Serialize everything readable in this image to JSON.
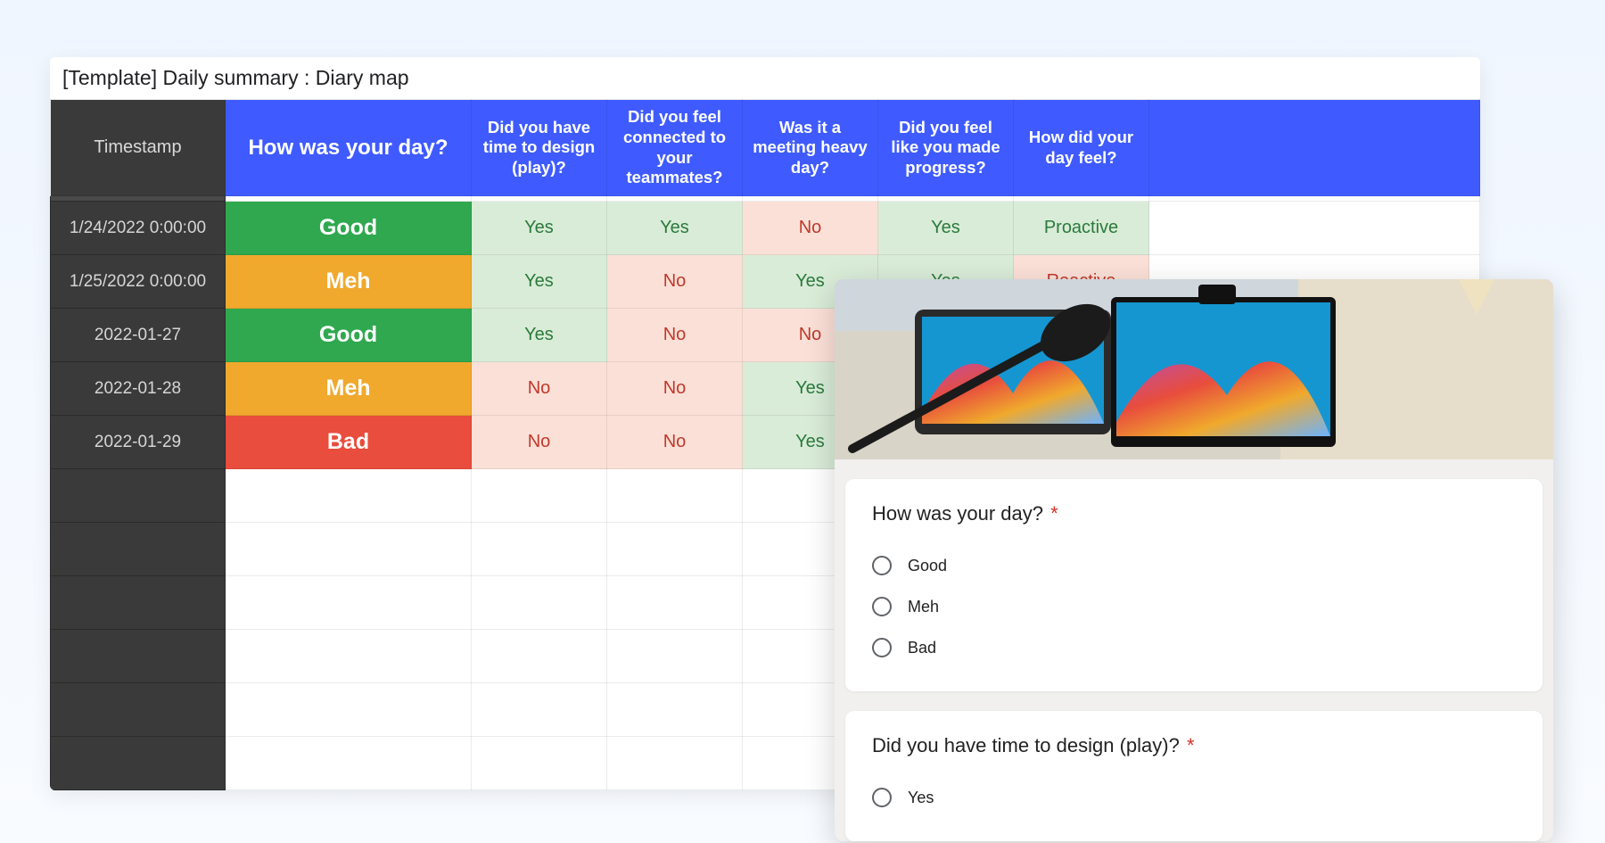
{
  "sheet": {
    "title": "[Template] Daily summary : Diary map",
    "headers": {
      "timestamp": "Timestamp",
      "day": "How was your day?",
      "q_design": "Did you have time to design (play)?",
      "q_connected": "Did you feel connected to your teammates?",
      "q_meeting": "Was it a meeting heavy day?",
      "q_progress": "Did you feel like you made progress?",
      "q_feel": "How did your day feel?"
    },
    "rows": [
      {
        "ts": "1/24/2022 0:00:00",
        "day": "Good",
        "design": "Yes",
        "connected": "Yes",
        "meeting": "No",
        "progress": "Yes",
        "feel": "Proactive"
      },
      {
        "ts": "1/25/2022 0:00:00",
        "day": "Meh",
        "design": "Yes",
        "connected": "No",
        "meeting": "Yes",
        "progress": "Yes",
        "feel": "Reactive"
      },
      {
        "ts": "2022-01-27",
        "day": "Good",
        "design": "Yes",
        "connected": "No",
        "meeting": "No",
        "progress": "",
        "feel": ""
      },
      {
        "ts": "2022-01-28",
        "day": "Meh",
        "design": "No",
        "connected": "No",
        "meeting": "Yes",
        "progress": "",
        "feel": ""
      },
      {
        "ts": "2022-01-29",
        "day": "Bad",
        "design": "No",
        "connected": "No",
        "meeting": "Yes",
        "progress": "",
        "feel": ""
      }
    ],
    "empty_rows": 6
  },
  "form": {
    "q1": {
      "title": "How was your day?",
      "required": "*",
      "options": [
        "Good",
        "Meh",
        "Bad"
      ]
    },
    "q2": {
      "title": "Did you have time to design (play)?",
      "required": "*",
      "options": [
        "Yes"
      ]
    }
  }
}
